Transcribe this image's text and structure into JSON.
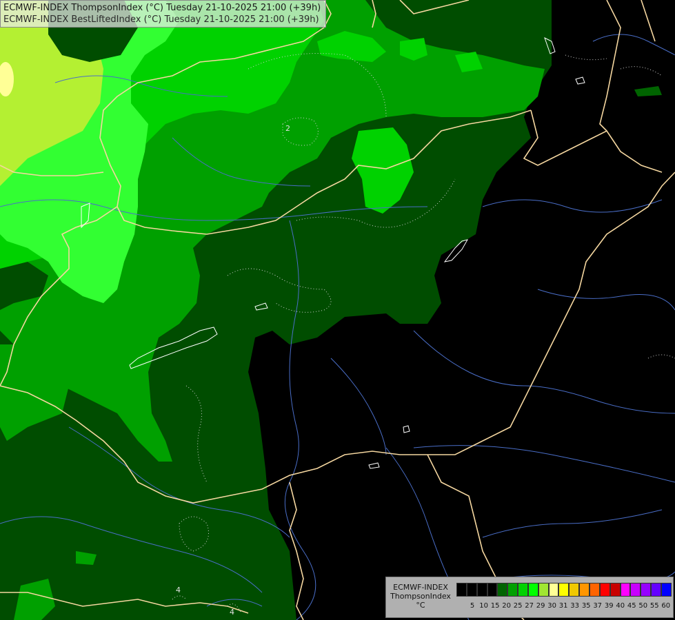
{
  "title": {
    "line1": "ECMWF-INDEX ThompsonIndex (°C) Tuesday 21-10-2025 21:00 (+39h)",
    "line2": "ECMWF-INDEX BestLiftedIndex (°C) Tuesday 21-10-2025 21:00 (+39h)"
  },
  "contour_labels": [
    "2",
    "4",
    "4"
  ],
  "legend": {
    "line1": "ECMWF-INDEX",
    "line2": "ThompsonIndex",
    "line3": "°C",
    "colors": [
      "#000000",
      "#000000",
      "#000000",
      "#000000",
      "#006400",
      "#00a000",
      "#00d200",
      "#00ff00",
      "#a0e632",
      "#ffff96",
      "#ffff00",
      "#f0c800",
      "#ff9600",
      "#ff6400",
      "#ff0000",
      "#c80000",
      "#ff00ff",
      "#c800ff",
      "#9600ff",
      "#6400ff",
      "#0000ff"
    ],
    "ticks": [
      "5",
      "10",
      "15",
      "20",
      "25",
      "27",
      "29",
      "30",
      "31",
      "33",
      "35",
      "37",
      "39",
      "40",
      "45",
      "50",
      "55",
      "60"
    ]
  },
  "colors": {
    "darkgreen": "#004d00",
    "midgreen": "#00a000",
    "brightgreen": "#00e000",
    "lightgreen": "#32ff32",
    "yellowgreen": "#b4f032",
    "border": "#f5d7a0",
    "rivers": "#4a6ec8"
  }
}
